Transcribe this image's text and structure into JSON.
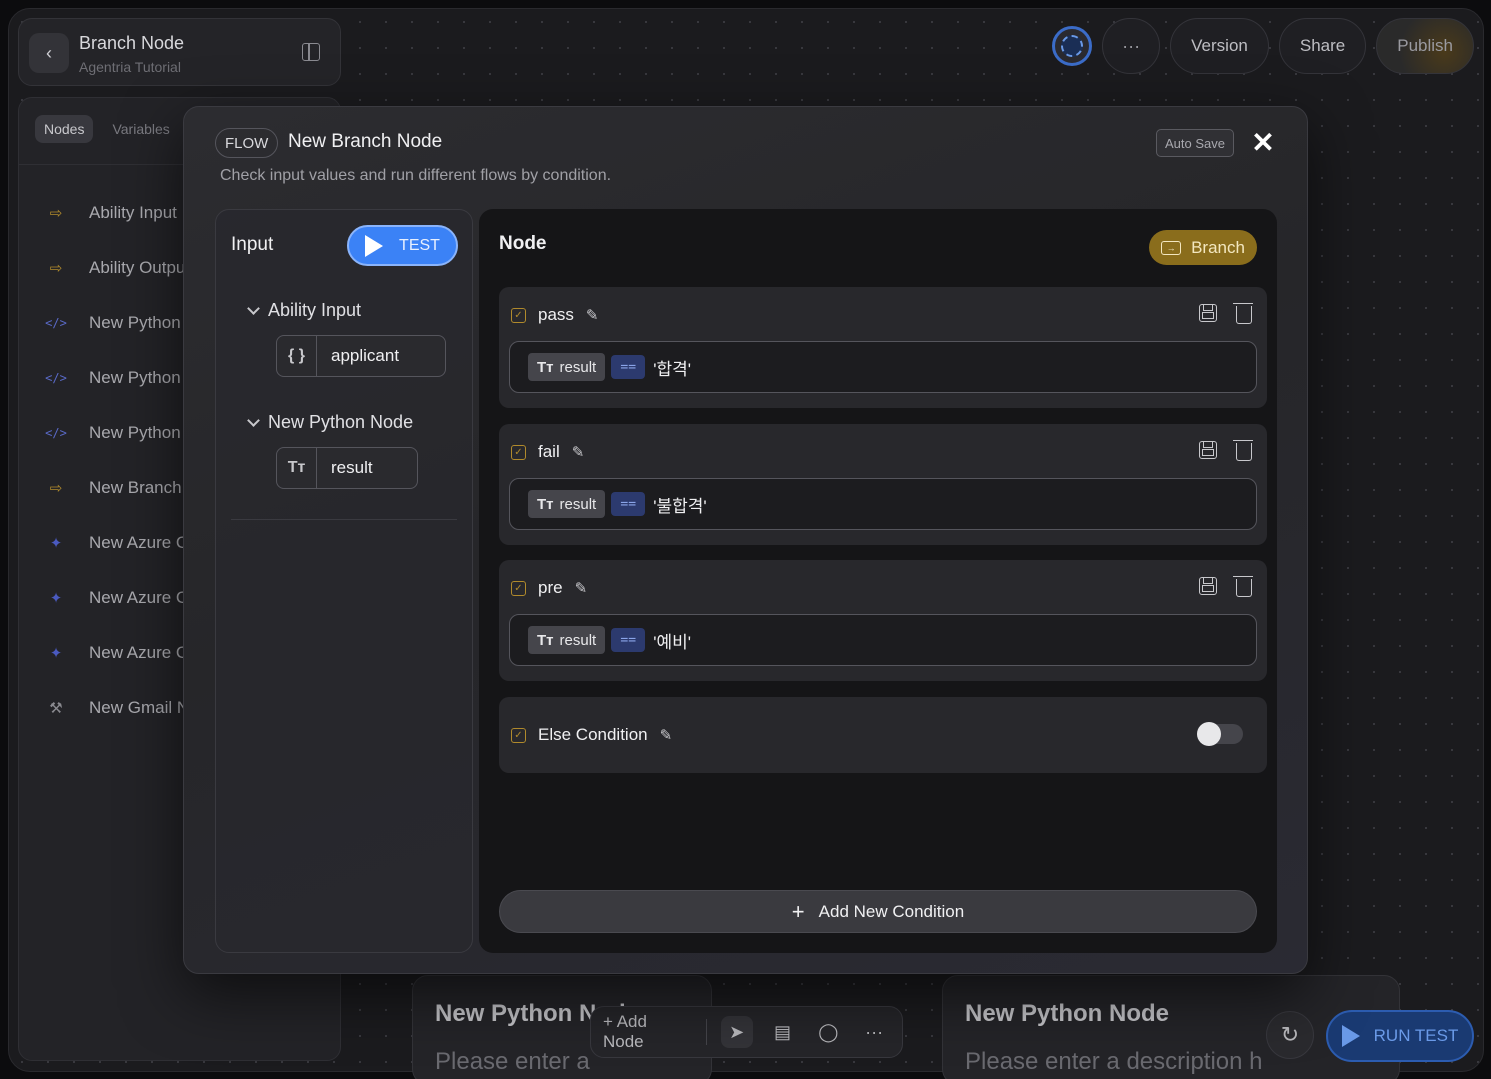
{
  "header": {
    "title": "Branch Node",
    "subtitle": "Agentria Tutorial",
    "more_label": "···",
    "version_label": "Version",
    "share_label": "Share",
    "publish_label": "Publish"
  },
  "sidebar": {
    "tabs": [
      {
        "label": "Nodes",
        "active": true
      },
      {
        "label": "Variables",
        "active": false
      }
    ],
    "items": [
      {
        "label": "Ability Input",
        "icon": "branch-icon"
      },
      {
        "label": "Ability Outpu",
        "icon": "branch-icon"
      },
      {
        "label": "New Python",
        "icon": "code-icon"
      },
      {
        "label": "New Python",
        "icon": "code-icon"
      },
      {
        "label": "New Python",
        "icon": "code-icon"
      },
      {
        "label": "New Branch",
        "icon": "branch-icon"
      },
      {
        "label": "New Azure C",
        "icon": "sparkle-icon"
      },
      {
        "label": "New Azure C",
        "icon": "sparkle-icon"
      },
      {
        "label": "New Azure C",
        "icon": "sparkle-icon"
      },
      {
        "label": "New Gmail N",
        "icon": "tools-icon"
      }
    ]
  },
  "background": {
    "card1": {
      "title": "New Python Node",
      "description": "Please enter a"
    },
    "card2": {
      "title": "New Python Node",
      "description": "Please enter a description h"
    }
  },
  "toolbar": {
    "add_node_label": "+ Add Node",
    "more_label": "···"
  },
  "run_test_label": "RUN TEST",
  "modal": {
    "badge": "FLOW",
    "title": "New Branch Node",
    "description": "Check input values and run different flows by condition.",
    "autosave_label": "Auto Save",
    "close_label": "✕",
    "input_panel": {
      "title": "Input",
      "test_label": "TEST",
      "groups": [
        {
          "name": "Ability Input",
          "var": {
            "label": "applicant",
            "icon": "braces-icon",
            "icon_text": "{ }"
          }
        },
        {
          "name": "New Python Node",
          "var": {
            "label": "result",
            "icon": "text-type-icon",
            "icon_text": "Tт"
          }
        }
      ]
    },
    "node_panel": {
      "title": "Node",
      "branch_label": "Branch",
      "conditions": [
        {
          "name": "pass",
          "var": "result",
          "op": "==",
          "value": "'합격'"
        },
        {
          "name": "fail",
          "var": "result",
          "op": "==",
          "value": "'불합격'"
        },
        {
          "name": "pre",
          "var": "result",
          "op": "==",
          "value": "'예비'"
        }
      ],
      "else_condition": {
        "name": "Else Condition",
        "enabled": false
      },
      "add_condition_label": "Add New Condition"
    }
  },
  "colors": {
    "accent_blue": "#3b82f6",
    "branch_gold": "#8a6d1c",
    "operator_blue": "#2c3a6e"
  }
}
